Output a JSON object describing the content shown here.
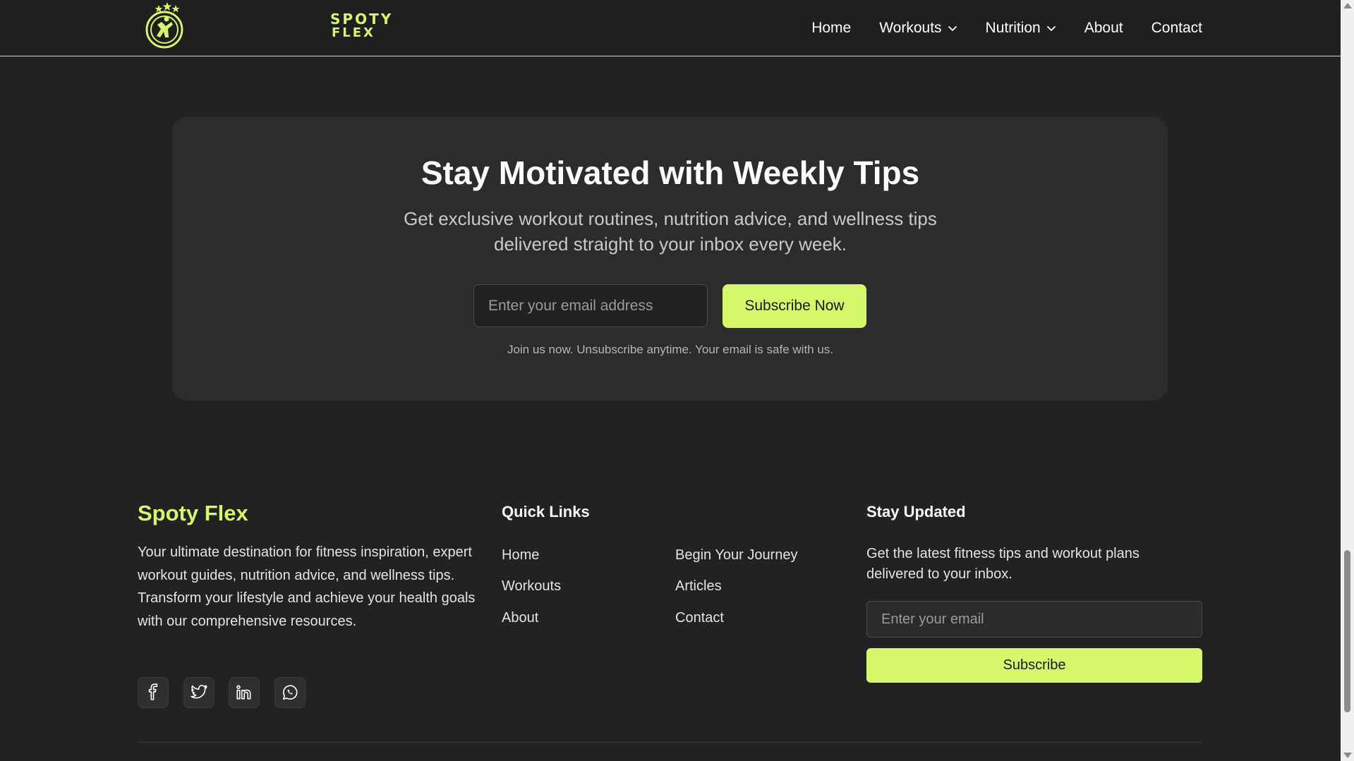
{
  "navbar": {
    "logo": {
      "line1": "SPOTY",
      "line2": "FLEX"
    },
    "items": [
      {
        "label": "Home",
        "dropdown": false
      },
      {
        "label": "Workouts",
        "dropdown": true
      },
      {
        "label": "Nutrition",
        "dropdown": true
      },
      {
        "label": "About",
        "dropdown": false
      },
      {
        "label": "Contact",
        "dropdown": false
      }
    ]
  },
  "newsletter": {
    "title": "Stay Motivated with Weekly Tips",
    "subtitle_line1": "Get exclusive workout routines, nutrition advice, and wellness tips",
    "subtitle_line2": "delivered straight to your inbox every week.",
    "input_placeholder": "Enter your email address",
    "button_label": "Subscribe Now",
    "note": "Join us now. Unsubscribe anytime. Your email is safe with us."
  },
  "footer": {
    "brand": {
      "name": "Spoty Flex",
      "description": "Your ultimate destination for fitness inspiration, expert workout guides, nutrition advice, and wellness tips. Transform your lifestyle and achieve your health goals with our comprehensive resources.",
      "social": [
        "facebook-icon",
        "twitter-icon",
        "linkedin-icon",
        "whatsapp-icon"
      ]
    },
    "quick_links": {
      "title": "Quick Links",
      "col1": [
        "Home",
        "Workouts",
        "About"
      ],
      "col2": [
        "Begin Your Journey",
        "Articles",
        "Contact"
      ]
    },
    "stay_updated": {
      "title": "Stay Updated",
      "description": "Get the latest fitness tips and workout plans delivered to your inbox.",
      "input_placeholder": "Enter your email",
      "button_label": "Subscribe"
    }
  },
  "colors": {
    "accent": "#d4f76b",
    "background": "#222222",
    "card": "#2c2c2c"
  }
}
